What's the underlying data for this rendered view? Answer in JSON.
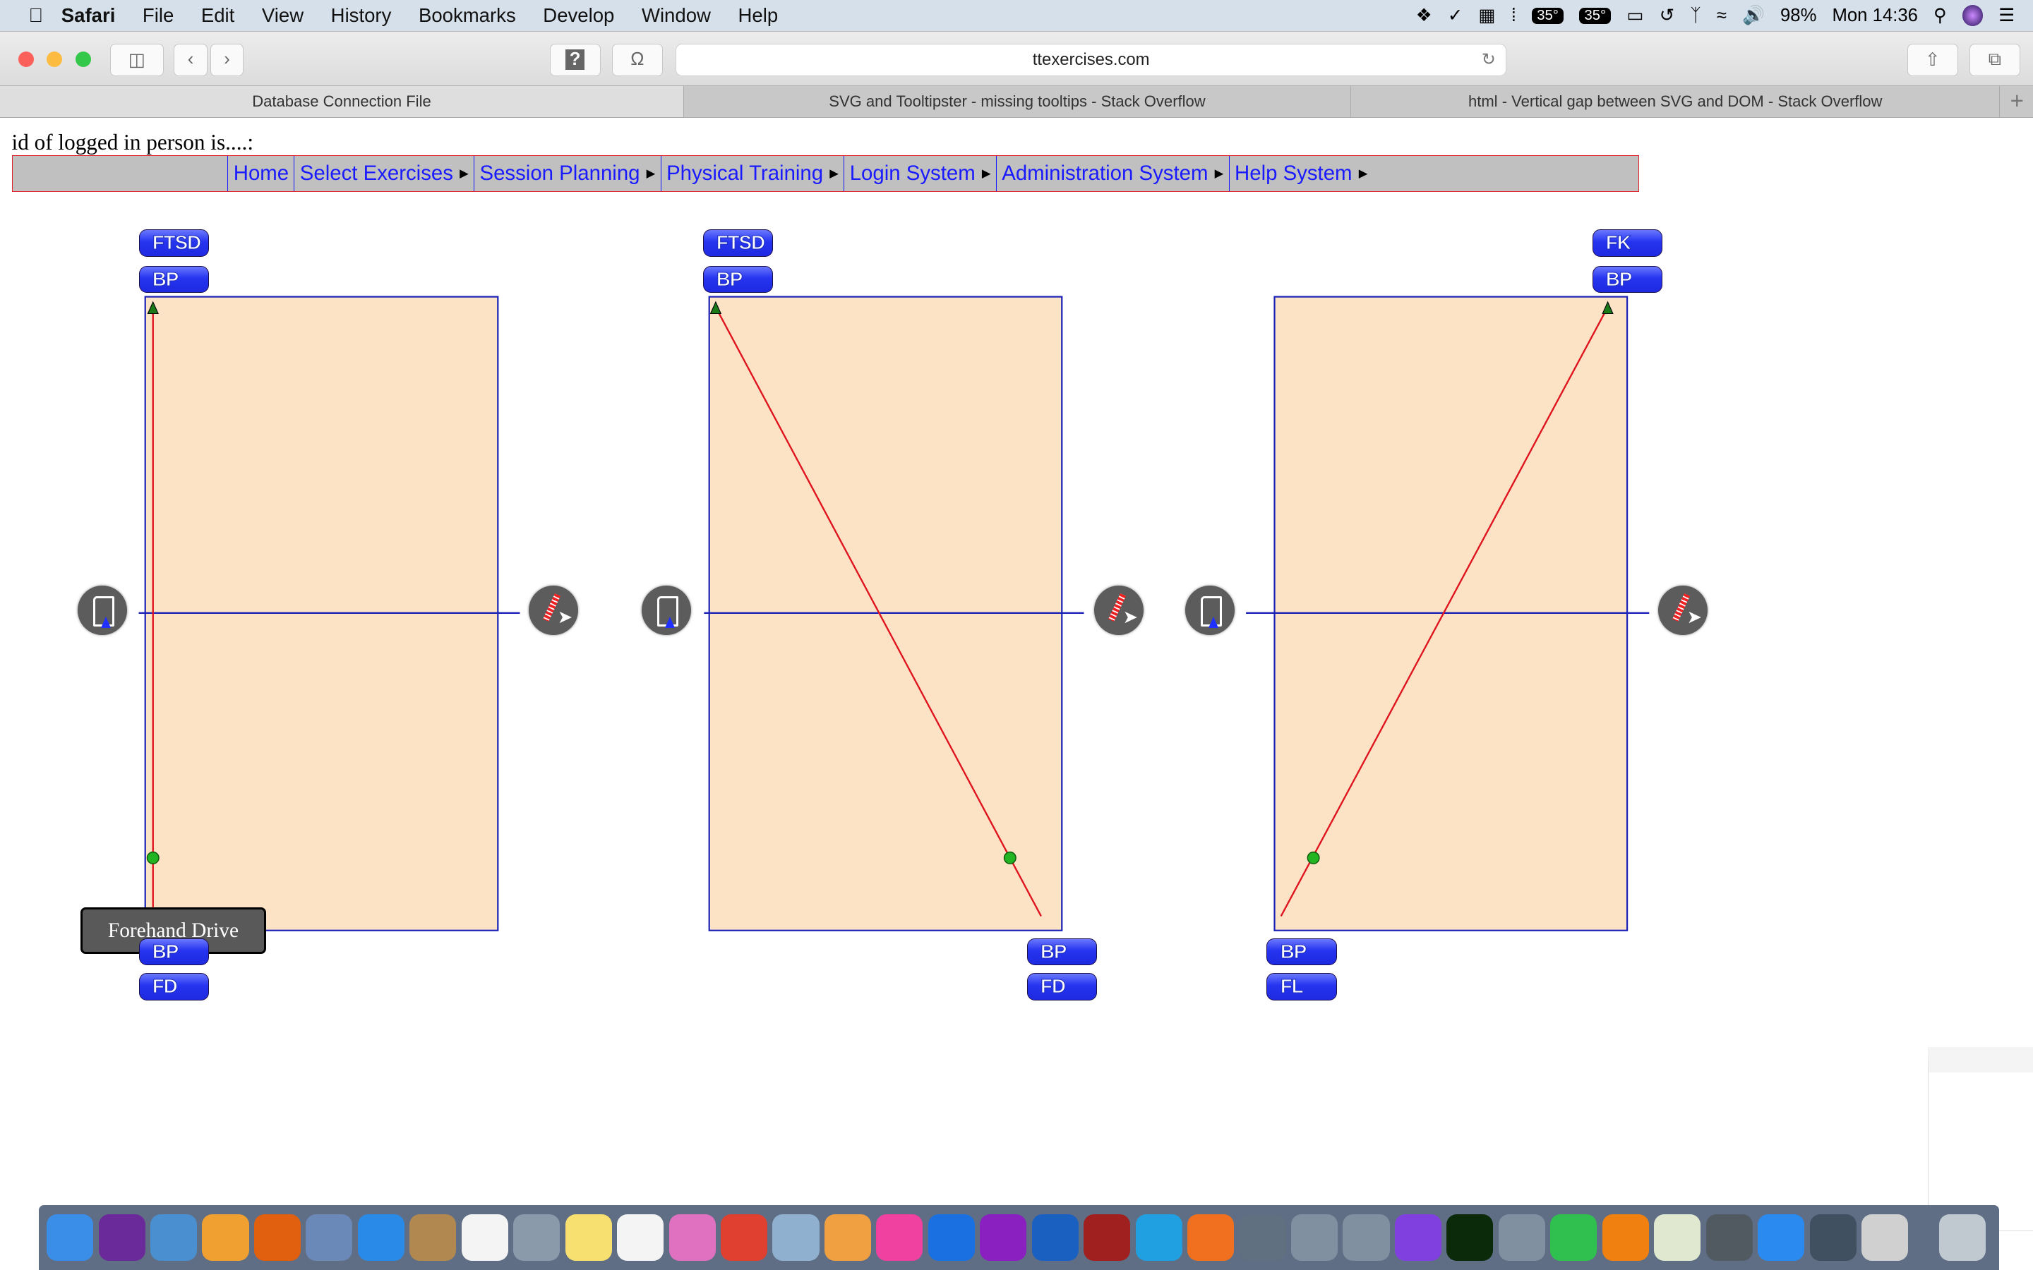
{
  "menubar": {
    "app": "Safari",
    "items": [
      "File",
      "Edit",
      "View",
      "History",
      "Bookmarks",
      "Develop",
      "Window",
      "Help"
    ],
    "status": {
      "temp1": "35°",
      "temp2": "35°",
      "battery": "98%",
      "clock": "Mon 14:36"
    }
  },
  "browser": {
    "url": "ttexercises.com",
    "tabs": [
      {
        "label": "Database Connection File",
        "active": true
      },
      {
        "label": "SVG and Tooltipster - missing tooltips - Stack Overflow"
      },
      {
        "label": "html - Vertical gap between SVG and DOM - Stack Overflow"
      }
    ],
    "new_tab": "+"
  },
  "page": {
    "id_text": "id of logged in person is....:",
    "nav": [
      {
        "label": "Home"
      },
      {
        "label": "Select Exercises",
        "submenu": true
      },
      {
        "label": "Session Planning",
        "submenu": true
      },
      {
        "label": "Physical Training",
        "submenu": true
      },
      {
        "label": "Login System",
        "submenu": true
      },
      {
        "label": "Administration System",
        "submenu": true
      },
      {
        "label": "Help System",
        "submenu": true
      }
    ],
    "courts": [
      {
        "top_buttons": [
          "FTSD",
          "BP"
        ],
        "bottom_buttons": [
          "BP",
          "FD"
        ]
      },
      {
        "top_buttons": [
          "FTSD",
          "BP"
        ],
        "bottom_buttons": [
          "BP",
          "FD"
        ]
      },
      {
        "top_buttons": [
          "FK",
          "BP"
        ],
        "bottom_buttons": [
          "BP",
          "FL"
        ]
      }
    ],
    "tooltip": "Forehand Drive",
    "colors": {
      "court": "#fce3c6",
      "court_border": "#1a22b8",
      "stroke_line": "#e0141e",
      "marker": "#22b422",
      "button": "#2634f0"
    }
  },
  "dock": {
    "icons": [
      "finder",
      "siri",
      "keynote",
      "photos",
      "firefox",
      "notes-list",
      "safari",
      "contacts",
      "calendar",
      "launchpad",
      "notes",
      "numbers",
      "pages-tools",
      "chrome",
      "preview",
      "pages",
      "itunes",
      "youtube",
      "affinity-photo",
      "affinity-designer",
      "photo-booth",
      "skype",
      "studio",
      "dvd-player",
      "unknown-app",
      "unknown-app",
      "imovie",
      "dreamweaver",
      "unknown-app",
      "facetime",
      "ibooks",
      "maps",
      "system-preferences",
      "app-store",
      "script-editor",
      "grapher",
      "trash"
    ]
  }
}
